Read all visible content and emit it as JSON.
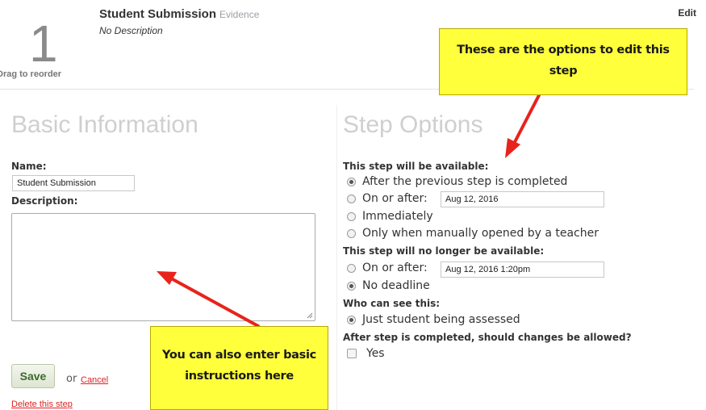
{
  "header": {
    "step_number": "1",
    "drag_hint": "Drag to reorder",
    "title": "Student Submission",
    "subtitle": "Evidence",
    "description": "No Description",
    "edit_label": "Edit"
  },
  "basic_info": {
    "heading": "Basic Information",
    "name_label": "Name:",
    "name_value": "Student Submission",
    "description_label": "Description:",
    "description_value": "",
    "save_label": "Save",
    "or_label": "or",
    "cancel_label": "Cancel",
    "delete_label": "Delete this step"
  },
  "step_options": {
    "heading": "Step Options",
    "available_label": "This step will be available:",
    "available_options": [
      {
        "label": "After the previous step is completed",
        "checked": true
      },
      {
        "label": "On or after:",
        "checked": false,
        "date_value": "Aug 12, 2016"
      },
      {
        "label": "Immediately",
        "checked": false
      },
      {
        "label": "Only when manually opened by a teacher",
        "checked": false
      }
    ],
    "unavailable_label": "This step will no longer be available:",
    "unavailable_options": [
      {
        "label": "On or after:",
        "checked": false,
        "date_value": "Aug 12, 2016 1:20pm"
      },
      {
        "label": "No deadline",
        "checked": true
      }
    ],
    "visibility_label": "Who can see this:",
    "visibility_options": [
      {
        "label": "Just student being assessed",
        "checked": true
      }
    ],
    "changes_label": "After step is completed, should changes be allowed?",
    "changes_option": {
      "label": "Yes",
      "checked": false
    }
  },
  "callouts": {
    "options_callout": "These are the options to edit this step",
    "options_callout_line1": "These are the options to edit this",
    "options_callout_line2": "step",
    "basic_callout_line1": "You can also enter basic",
    "basic_callout_line2": "instructions here"
  },
  "colors": {
    "callout_fill": "#ffff3b",
    "arrow": "#e8231b",
    "link": "#d22222",
    "heading": "#cfcfcf"
  }
}
